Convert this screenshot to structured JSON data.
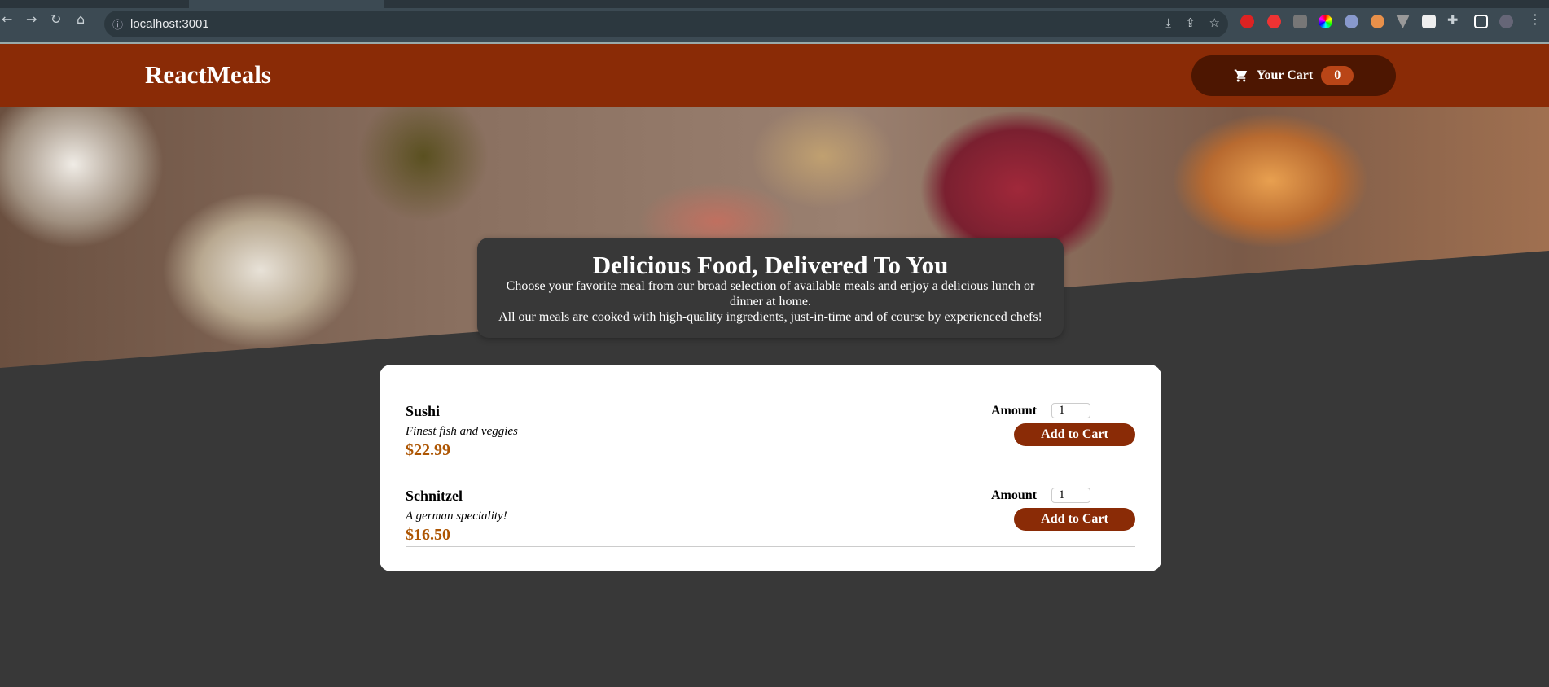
{
  "browser": {
    "url": "localhost:3001",
    "colors": {
      "toolbar": "#3c4a53"
    }
  },
  "header": {
    "logo": "ReactMeals",
    "cart_label": "Your Cart",
    "cart_count": "0",
    "cart_icon": "cart-icon"
  },
  "summary": {
    "title": "Delicious Food, Delivered To You",
    "p1": "Choose your favorite meal from our broad selection of available meals and enjoy a delicious lunch or dinner at home.",
    "p2": "All our meals are cooked with high-quality ingredients, just-in-time and of course by experienced chefs!"
  },
  "meals": [
    {
      "name": "Sushi",
      "description": "Finest fish and veggies",
      "price": "$22.99",
      "amount_label": "Amount",
      "amount": "1",
      "button": "Add to Cart"
    },
    {
      "name": "Schnitzel",
      "description": "A german speciality!",
      "price": "$16.50",
      "amount_label": "Amount",
      "amount": "1",
      "button": "Add to Cart"
    }
  ],
  "colors": {
    "primary": "#8a2b06",
    "price": "#ad5502",
    "background": "#383838"
  }
}
